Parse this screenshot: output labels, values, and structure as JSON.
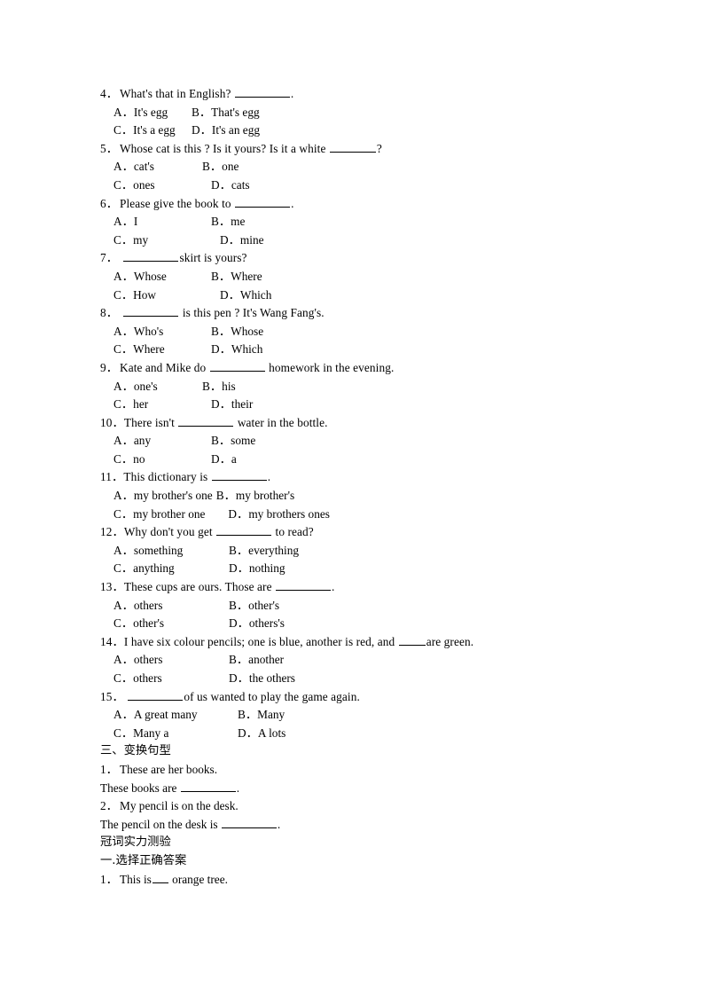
{
  "document": {
    "title_text_present": false,
    "questions": [
      {
        "number": "4．",
        "stem_before": "What's that in English?",
        "blank": "long",
        "stem_after": ".",
        "options": [
          {
            "label": "A．",
            "text": "It's egg"
          },
          {
            "label": "B．",
            "text": "That's egg"
          },
          {
            "label": "C．",
            "text": "It's a egg"
          },
          {
            "label": "D．",
            "text": "It's an egg"
          }
        ],
        "col_width": "w-88"
      },
      {
        "number": "5．",
        "stem_before": "Whose cat is this ? Is it yours? Is it a white",
        "blank": "med",
        "stem_after": "?",
        "options": [
          {
            "label": "A．",
            "text": "cat's"
          },
          {
            "label": "B．",
            "text": "one"
          },
          {
            "label": "C．",
            "text": "ones"
          },
          {
            "label": "D．",
            "text": "cats"
          }
        ],
        "col_width": "w-100"
      },
      {
        "number": "6．",
        "stem_before": "Please give the book to",
        "blank": "long",
        "stem_after": ".",
        "options": [
          {
            "label": "A．",
            "text": "I"
          },
          {
            "label": "B．",
            "text": "me"
          },
          {
            "label": "C．",
            "text": "my"
          },
          {
            "label": "D．",
            "text": "mine"
          }
        ],
        "col_width": "w-110"
      },
      {
        "number": "7．",
        "stem_before": "",
        "blank": "long",
        "stem_after": "skirt is yours?",
        "options": [
          {
            "label": "A．",
            "text": "Whose"
          },
          {
            "label": "B．",
            "text": "Where"
          },
          {
            "label": "C．",
            "text": "How"
          },
          {
            "label": "D．",
            "text": "Which"
          }
        ],
        "col_width": "w-110"
      },
      {
        "number": "8．",
        "stem_before": "",
        "blank": "long",
        "stem_after": "is this pen ? It's Wang Fang's.",
        "options": [
          {
            "label": "A．",
            "text": "Who's"
          },
          {
            "label": "B．",
            "text": "Whose"
          },
          {
            "label": "C．",
            "text": "Where"
          },
          {
            "label": "D．",
            "text": "Which"
          }
        ],
        "col_width": "w-110"
      },
      {
        "number": "9．",
        "stem_before": "Kate and Mike do",
        "blank": "long",
        "stem_after": "homework in the evening.",
        "options": [
          {
            "label": "A．",
            "text": "one's"
          },
          {
            "label": "B．",
            "text": "his"
          },
          {
            "label": "C．",
            "text": "her"
          },
          {
            "label": "D．",
            "text": "their"
          }
        ],
        "col_width": "w-100"
      },
      {
        "number": "10．",
        "stem_before": "There isn't",
        "blank": "long",
        "stem_after": "water in the bottle.",
        "options": [
          {
            "label": "A．",
            "text": "any"
          },
          {
            "label": "B．",
            "text": "some"
          },
          {
            "label": "C．",
            "text": "no"
          },
          {
            "label": "D．",
            "text": "a"
          }
        ],
        "col_width": "w-110"
      },
      {
        "number": "11．",
        "stem_before": "This dictionary is",
        "blank": "long",
        "stem_after": ".",
        "options": [
          {
            "label": "A．",
            "text": "my brother's one"
          },
          {
            "label": "B．",
            "text": "my brother's"
          },
          {
            "label": "C．",
            "text": "my brother one"
          },
          {
            "label": "D．",
            "text": "my brothers ones"
          }
        ],
        "col_width": "w-auto"
      },
      {
        "number": "12．",
        "stem_before": "Why don't you get",
        "blank": "long",
        "stem_after": "to read?",
        "options": [
          {
            "label": "A．",
            "text": "something"
          },
          {
            "label": "B．",
            "text": "everything"
          },
          {
            "label": "C．",
            "text": "anything"
          },
          {
            "label": "D．",
            "text": "nothing"
          }
        ],
        "col_width": "w-130"
      },
      {
        "number": "13．",
        "stem_before": "These cups are ours. Those are",
        "blank": "long",
        "stem_after": ".",
        "options": [
          {
            "label": "A．",
            "text": "others"
          },
          {
            "label": "B．",
            "text": "other's"
          },
          {
            "label": "C．",
            "text": "other's"
          },
          {
            "label": "D．",
            "text": "others's"
          }
        ],
        "col_width": "w-130"
      },
      {
        "number": "14．",
        "stem_before": "I have six colour pencils; one is blue, another is red, and",
        "blank": "short",
        "stem_after": "are green.",
        "options": [
          {
            "label": "A．",
            "text": "others"
          },
          {
            "label": "B．",
            "text": "another"
          },
          {
            "label": "C．",
            "text": "others"
          },
          {
            "label": "D．",
            "text": "the others"
          }
        ],
        "col_width": "w-130"
      },
      {
        "number": "15．",
        "stem_before": "",
        "blank": "long",
        "stem_after": "of us wanted to play the game again.",
        "options": [
          {
            "label": "A．",
            "text": "A great many"
          },
          {
            "label": "B．",
            "text": "Many"
          },
          {
            "label": "C．",
            "text": "Many a"
          },
          {
            "label": "D．",
            "text": "A lots"
          }
        ],
        "col_width": "w-140"
      }
    ],
    "section_three": {
      "heading": "三、变换句型",
      "items": [
        {
          "number": "1．",
          "text": "These are her books."
        },
        {
          "answer_prefix": "These books are",
          "blank": "long",
          "answer_suffix": "."
        },
        {
          "number": "2．",
          "text": "My pencil is on the desk."
        },
        {
          "answer_prefix": "The pencil on the desk is",
          "blank": "long",
          "answer_suffix": "."
        }
      ]
    },
    "article_test": {
      "heading": "冠词实力测验",
      "subheading": "一.选择正确答案",
      "question": {
        "number": "1．",
        "stem_before": "This is",
        "blank": "tiny",
        "stem_after": "orange tree."
      }
    }
  }
}
